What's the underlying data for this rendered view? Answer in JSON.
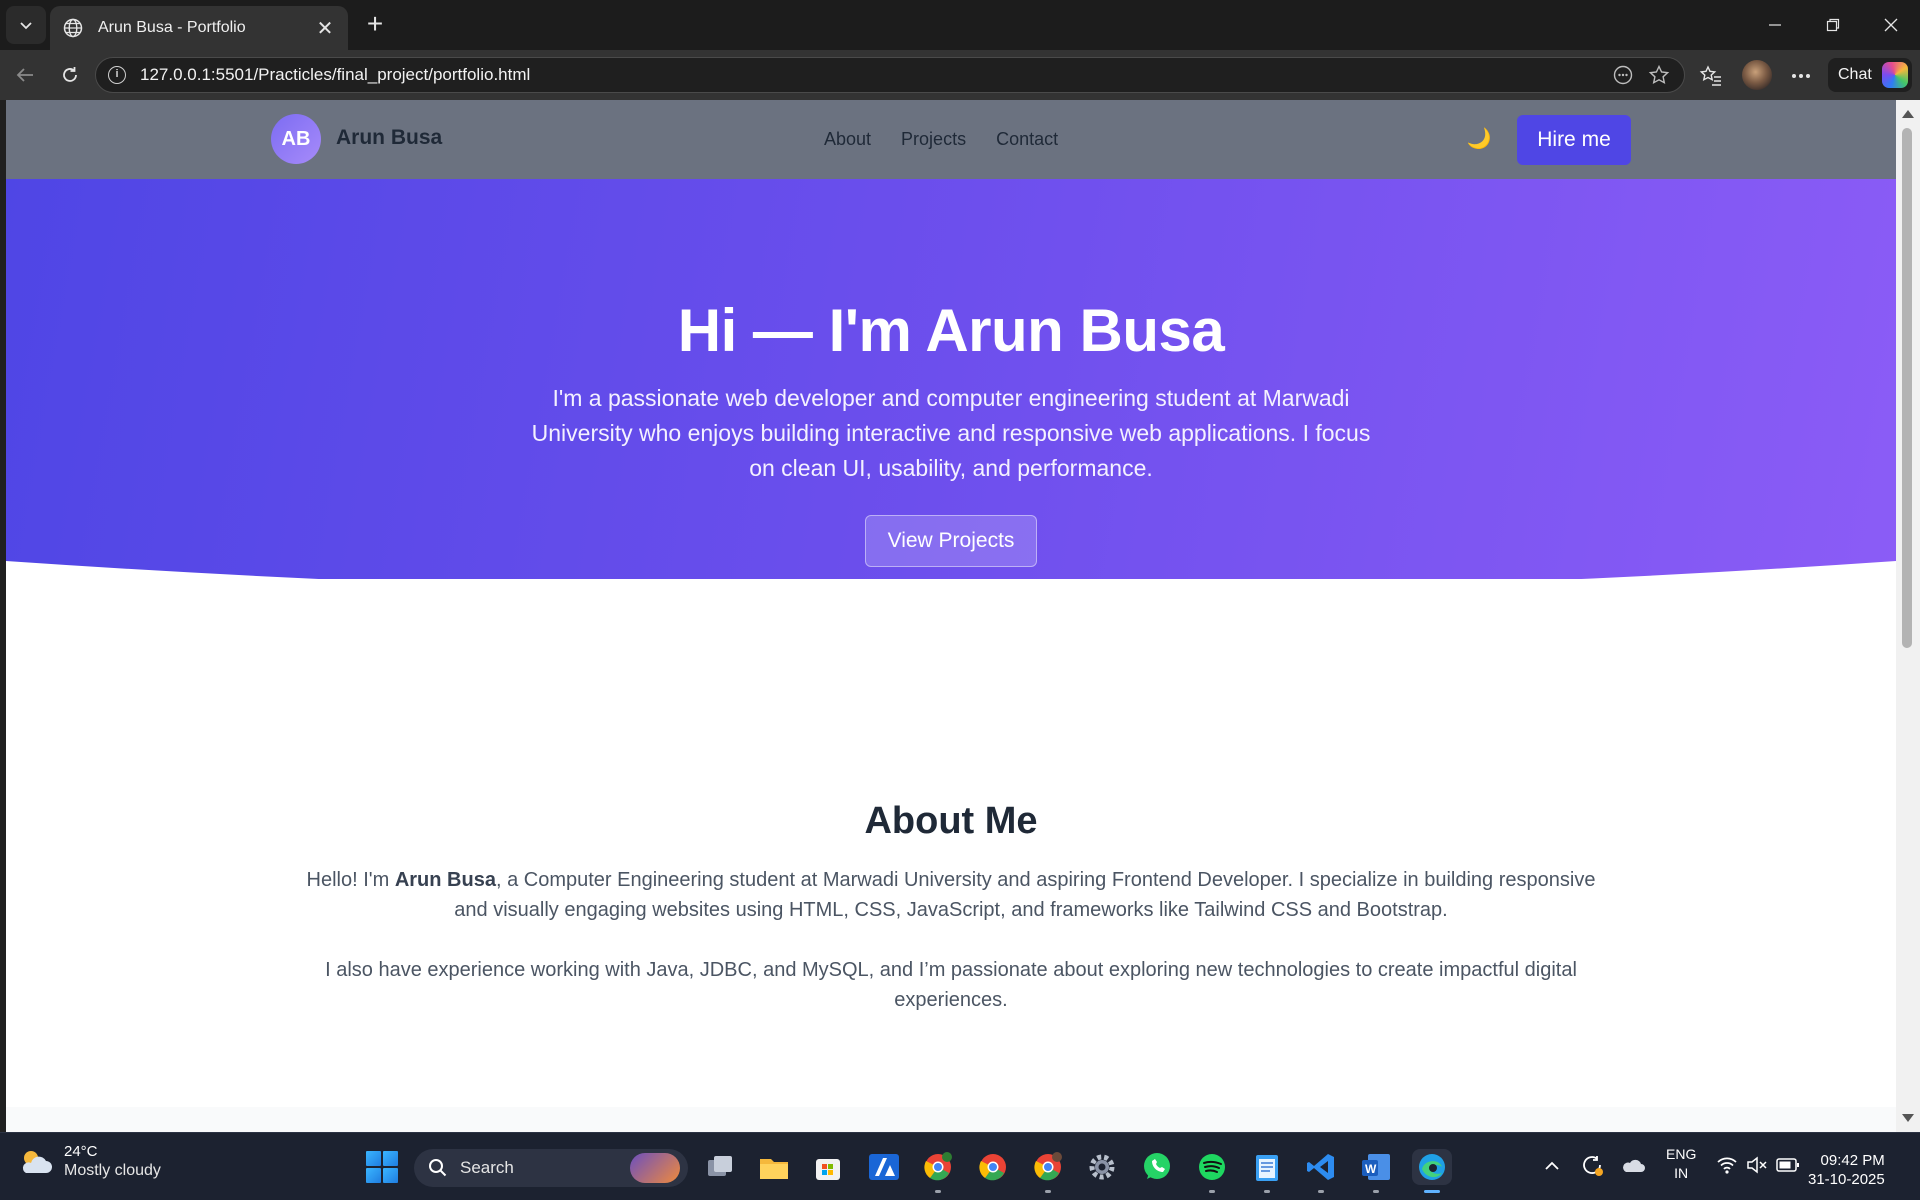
{
  "browser": {
    "tab_title": "Arun Busa - Portfolio",
    "url": "127.0.0.1:5501/Practicles/final_project/portfolio.html",
    "chat_label": "Chat"
  },
  "site": {
    "logo_initials": "AB",
    "logo_name": "Arun Busa",
    "nav": [
      "About",
      "Projects",
      "Contact"
    ],
    "theme_toggle_icon": "🌙",
    "hire_label": "Hire me"
  },
  "hero": {
    "title": "Hi — I'm Arun Busa",
    "subtitle": "I'm a passionate web developer and computer engineering student at Marwadi University who enjoys building interactive and responsive web applications. I focus on clean UI, usability, and performance.",
    "cta": "View Projects"
  },
  "about": {
    "heading": "About Me",
    "p1_prefix": "Hello! I'm ",
    "p1_name": "Arun Busa",
    "p1_suffix": ", a Computer Engineering student at Marwadi University and aspiring Frontend Developer. I specialize in building responsive and visually engaging websites using HTML, CSS, JavaScript, and frameworks like Tailwind CSS and Bootstrap.",
    "p2": "I also have experience working with Java, JDBC, and MySQL, and I’m passionate about exploring new technologies to create impactful digital experiences."
  },
  "taskbar": {
    "temperature": "24°C",
    "weather": "Mostly cloudy",
    "search_placeholder": "Search",
    "lang_top": "ENG",
    "lang_bottom": "IN",
    "time": "09:42 PM",
    "date": "31-10-2025"
  },
  "colors": {
    "accent": "#4f46e5",
    "hero_start": "#4f46e5",
    "hero_end": "#8b5cf6",
    "header_bg": "#6b7280"
  }
}
